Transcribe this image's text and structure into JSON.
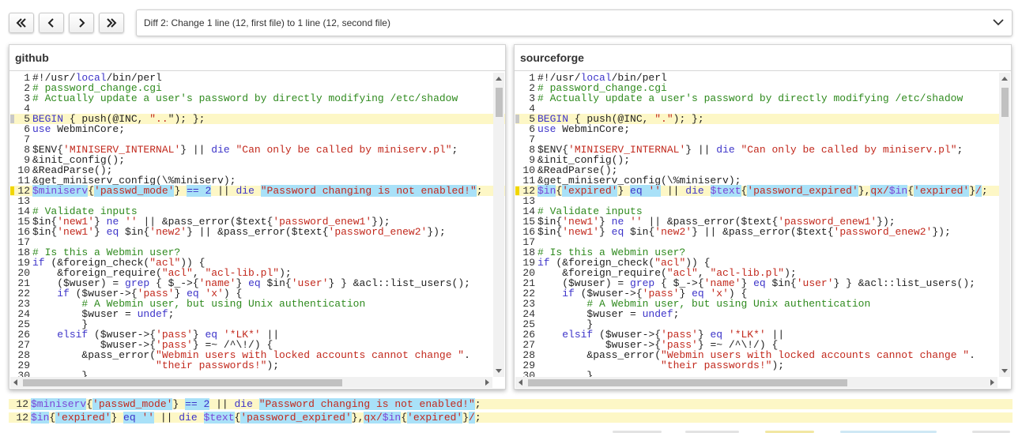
{
  "toolbar": {
    "buttons": [
      {
        "icon": "first-diff-icon"
      },
      {
        "icon": "previous-diff-icon"
      },
      {
        "icon": "next-diff-icon"
      },
      {
        "icon": "last-diff-icon"
      }
    ],
    "diff_selector": "Diff 2: Change 1 line (12, first file) to 1 line (12, second file)"
  },
  "left_panel": {
    "title": "github"
  },
  "right_panel": {
    "title": "sourceforge"
  },
  "colors": {
    "keyword": "#3d34c9",
    "string": "#c2291d",
    "comment": "#2f8a1e",
    "changed_line_bg": "#fdf7c6",
    "changed_token_bg": "#a9e1f8"
  },
  "line_numbers": [
    "1",
    "2",
    "3",
    "4",
    "5",
    "6",
    "7",
    "8",
    "9",
    "10",
    "11",
    "12",
    "13",
    "14",
    "15",
    "16",
    "17",
    "18",
    "19",
    "20",
    "21",
    "22",
    "23",
    "24",
    "25",
    "26",
    "27",
    "28",
    "29",
    "30"
  ],
  "bottom": {
    "line_left_num": "12",
    "line_right_num": "12"
  }
}
